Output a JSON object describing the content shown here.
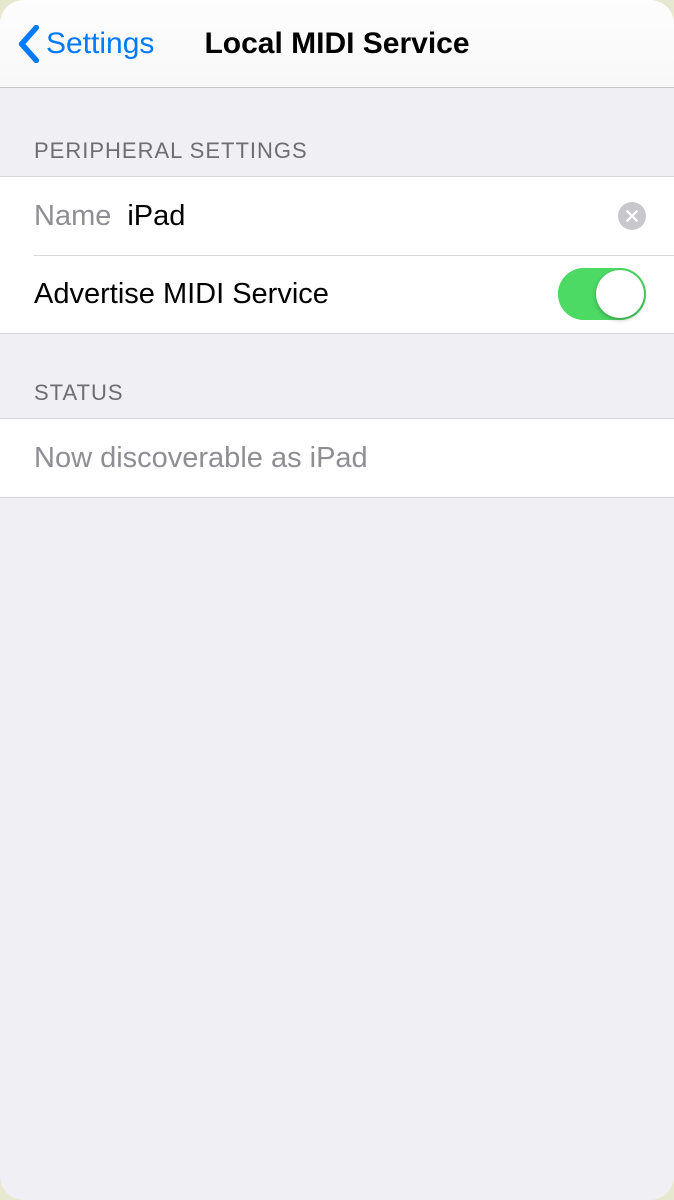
{
  "nav": {
    "back_label": "Settings",
    "title": "Local MIDI Service"
  },
  "peripheral": {
    "header": "Peripheral Settings",
    "name_label": "Name",
    "name_value": "iPad",
    "advertise_label": "Advertise MIDI Service",
    "advertise_on": true
  },
  "status": {
    "header": "Status",
    "message": "Now discoverable as iPad"
  }
}
